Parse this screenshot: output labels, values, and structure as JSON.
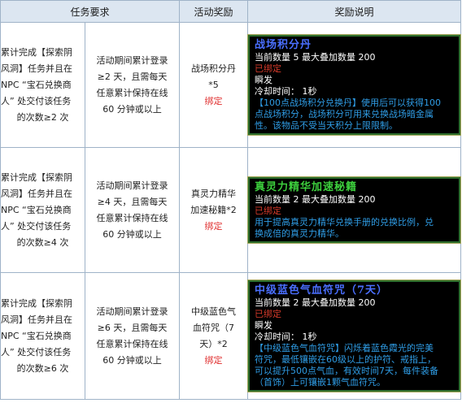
{
  "headers": [
    "任务要求",
    "活动奖励",
    "奖励说明"
  ],
  "rows": [
    {
      "req_lines": [
        "累计完成【探索阴",
        "风洞】任务并且在",
        "NPC “宝石兑换商",
        "人” 处交付该任务",
        "的次数≥2 次"
      ],
      "cond_lines": [
        "活动期间累计登录",
        "≥2 天，且需每天",
        "任意累计保持在线",
        "60 分钟或以上"
      ],
      "reward_lines": [
        "战场积分丹",
        "*5"
      ],
      "bind": "绑定",
      "card": {
        "title": "战场积分丹",
        "title_color": "#4a6fff",
        "lines": [
          "当前数量 5  最大叠加数量 200",
          "已绑定",
          "瞬发",
          "冷却时间： 1秒"
        ],
        "desc_lines": [
          "【100点战场积分兑换丹】使用后可以获得100",
          "点战场积分，战场积分可用来兑换战场暗金属",
          "性。该物品不受当天积分上限限制。"
        ]
      }
    },
    {
      "req_lines": [
        "累计完成【探索阴",
        "风洞】任务并且在",
        "NPC “宝石兑换商",
        "人” 处交付该任务",
        "的次数≥4 次"
      ],
      "cond_lines": [
        "活动期间累计登录",
        "≥4 天，且需每天",
        "任意累计保持在线",
        "60 分钟或以上"
      ],
      "reward_lines": [
        "真灵力精华",
        "加速秘籍*2"
      ],
      "bind": "绑定",
      "card": {
        "title": "真灵力精华加速秘籍",
        "title_color": "#3dcf3d",
        "lines": [
          "当前数量 2  最大叠加数量 200",
          "已绑定"
        ],
        "desc_lines": [
          "用于提高真灵力精华兑换手册的兑换比例，兑",
          "换成倍的真灵力精华。"
        ]
      }
    },
    {
      "req_lines": [
        "累计完成【探索阴",
        "风洞】任务并且在",
        "NPC “宝石兑换商",
        "人” 处交付该任务",
        "的次数≥6 次"
      ],
      "cond_lines": [
        "活动期间累计登录",
        "≥6 天，且需每天",
        "任意累计保持在线",
        "60 分钟或以上"
      ],
      "reward_lines": [
        "中级蓝色气",
        "血符咒（7",
        "天）*2"
      ],
      "bind": "绑定",
      "card": {
        "title": "中级蓝色气血符咒（7天）",
        "title_color": "#4a6fff",
        "lines": [
          "当前数量 2  最大叠加数量 200",
          "已绑定",
          "瞬发",
          "冷却时间： 1秒"
        ],
        "desc_lines": [
          "【中级蓝色气血符咒】闪烁着蓝色霞光的完美",
          "符咒，最低镶嵌在60级以上的护符、戒指上，",
          "可以提升500点气血，有效时间7天，每件装备",
          "（首饰）上可镶嵌1颗气血符咒。"
        ]
      }
    }
  ]
}
